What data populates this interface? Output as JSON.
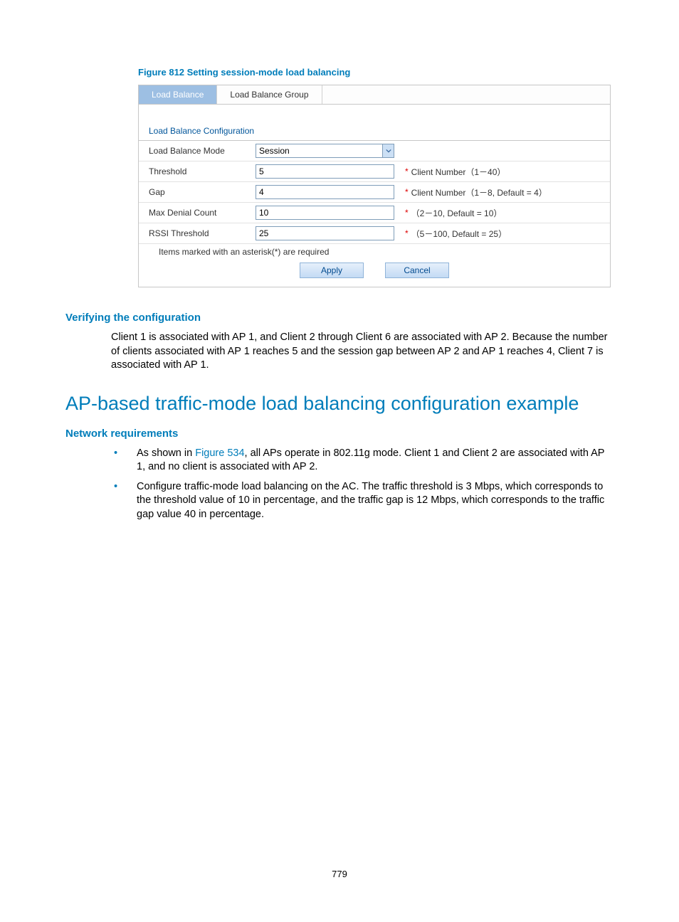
{
  "figure_caption": "Figure 812 Setting session-mode load balancing",
  "tabs": {
    "active": "Load Balance",
    "other": "Load Balance Group"
  },
  "config": {
    "section_title": "Load Balance Configuration",
    "rows": {
      "mode": {
        "label": "Load Balance Mode",
        "value": "Session"
      },
      "threshold": {
        "label": "Threshold",
        "value": "5",
        "hint": "Client Number（1－40）"
      },
      "gap": {
        "label": "Gap",
        "value": "4",
        "hint": "Client Number（1－8, Default = 4）"
      },
      "max_denial": {
        "label": "Max Denial Count",
        "value": "10",
        "hint": "（2－10, Default = 10）"
      },
      "rssi": {
        "label": "RSSI Threshold",
        "value": "25",
        "hint": "（5－100, Default = 25）"
      }
    },
    "required_note": "Items marked with an asterisk(*) are required",
    "buttons": {
      "apply": "Apply",
      "cancel": "Cancel"
    }
  },
  "verify": {
    "heading": "Verifying the configuration",
    "text": "Client 1 is associated with AP 1, and Client 2 through Client 6 are associated with AP 2. Because the number of clients associated with AP 1 reaches 5 and the session gap between AP 2 and AP 1 reaches 4, Client 7 is associated with AP 1."
  },
  "section2": {
    "heading": "AP-based traffic-mode load balancing configuration example",
    "subheading": "Network requirements",
    "bullet1_prefix": "As shown in ",
    "bullet1_link": "Figure 534",
    "bullet1_suffix": ", all APs operate in 802.11g mode. Client 1 and Client 2 are associated with AP 1, and no client is associated with AP 2.",
    "bullet2": "Configure traffic-mode load balancing on the AC. The traffic threshold is 3 Mbps, which corresponds to the threshold value of 10 in percentage, and the traffic gap is 12 Mbps, which corresponds to the traffic gap value 40 in percentage."
  },
  "page_number": "779"
}
